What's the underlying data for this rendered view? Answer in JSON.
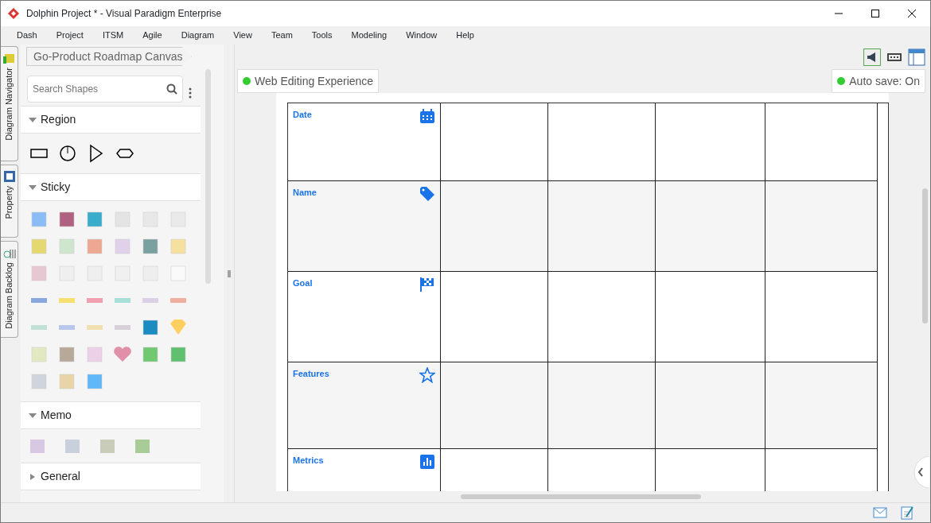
{
  "window": {
    "title": "Dolphin Project * - Visual Paradigm Enterprise"
  },
  "menu": [
    "Dash",
    "Project",
    "ITSM",
    "Agile",
    "Diagram",
    "View",
    "Team",
    "Tools",
    "Modeling",
    "Window",
    "Help"
  ],
  "side_tabs": [
    {
      "label": "Diagram Navigator"
    },
    {
      "label": "Property"
    },
    {
      "label": "Diagram Backlog"
    }
  ],
  "breadcrumb": "Go-Product Roadmap Canvas",
  "palette": {
    "search": {
      "placeholder": "Search Shapes"
    },
    "sections": [
      {
        "title": "Region",
        "expanded": true,
        "kind": "region"
      },
      {
        "title": "Sticky",
        "expanded": true,
        "kind": "sticky"
      },
      {
        "title": "Memo",
        "expanded": true,
        "kind": "memo"
      },
      {
        "title": "General",
        "expanded": false,
        "kind": "empty"
      }
    ]
  },
  "canvas": {
    "mode": "Web Editing Experience",
    "autosave": "Auto save: On",
    "rows": [
      {
        "label": "Date"
      },
      {
        "label": "Name"
      },
      {
        "label": "Goal"
      },
      {
        "label": "Features"
      },
      {
        "label": "Metrics"
      }
    ]
  }
}
